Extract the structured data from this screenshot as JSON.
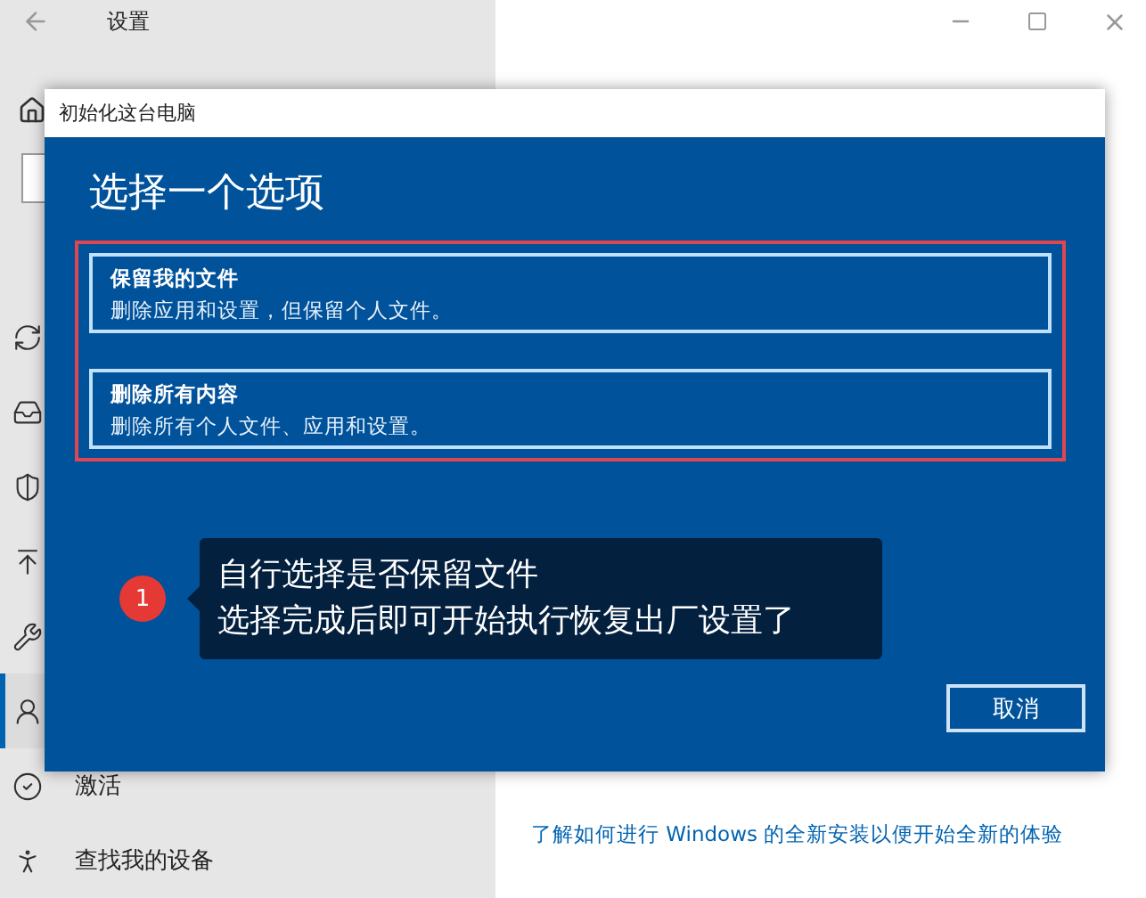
{
  "settings_window": {
    "title": "设置"
  },
  "sidebar": {
    "items": [
      {
        "selected": false
      },
      {
        "selected": false
      },
      {
        "selected": false
      },
      {
        "selected": false
      },
      {
        "selected": false
      },
      {
        "selected": true
      },
      {
        "label": "激活",
        "selected": false
      },
      {
        "label": "查找我的设备",
        "selected": false
      }
    ]
  },
  "main": {
    "link": "了解如何进行 Windows 的全新安装以便开始全新的体验"
  },
  "dialog": {
    "title": "初始化这台电脑",
    "heading": "选择一个选项",
    "options": [
      {
        "title": "保留我的文件",
        "description": "删除应用和设置，但保留个人文件。"
      },
      {
        "title": "删除所有内容",
        "description": "删除所有个人文件、应用和设置。"
      }
    ],
    "cancel": "取消"
  },
  "callout": {
    "number": "1",
    "lines": [
      "自行选择是否保留文件",
      "选择完成后即可开始执行恢复出厂设置了"
    ]
  }
}
